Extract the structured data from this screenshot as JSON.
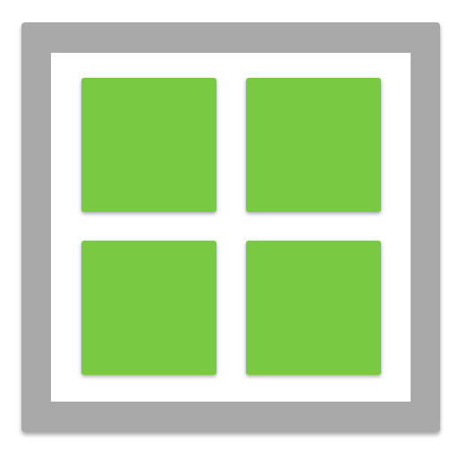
{
  "icon": {
    "name": "grid-layout-icon",
    "tile_count": 4,
    "colors": {
      "frame": "#a9a9a9",
      "background": "#ffffff",
      "tile": "#7ac943"
    }
  }
}
